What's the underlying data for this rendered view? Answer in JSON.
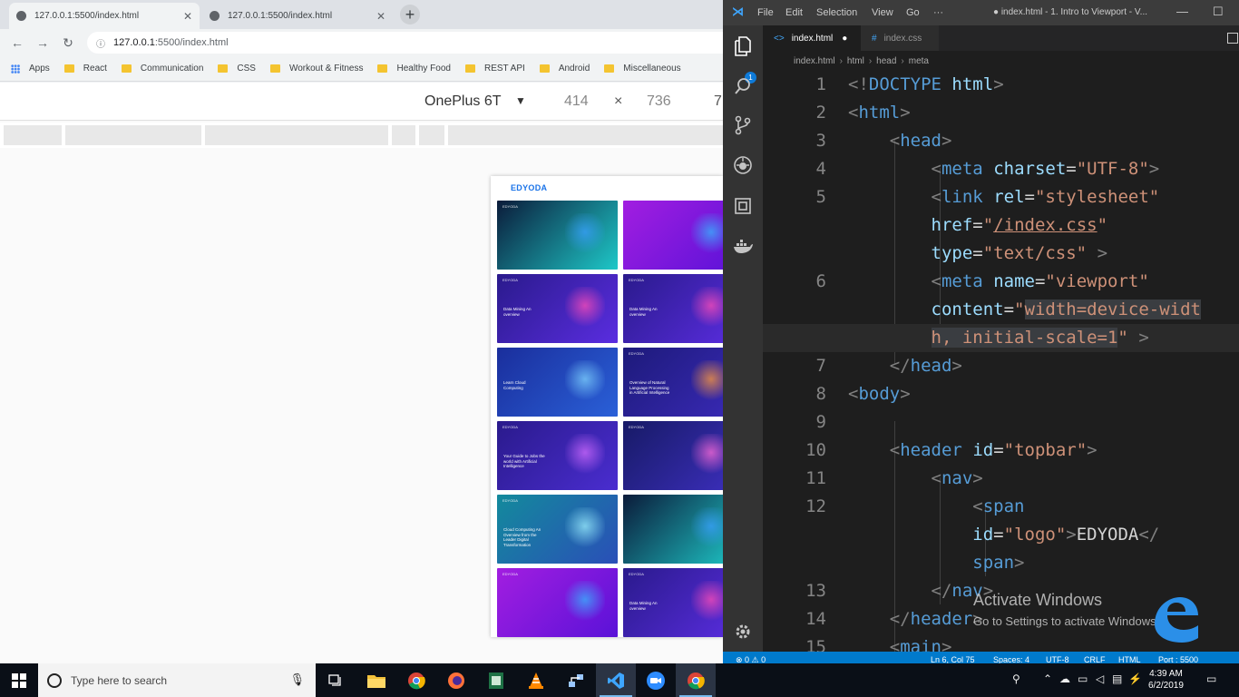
{
  "browser": {
    "tabs": [
      {
        "title": "127.0.0.1:5500/index.html",
        "close": "✕"
      },
      {
        "title": "127.0.0.1:5500/index.html",
        "close": "✕"
      }
    ],
    "new_tab": "+",
    "back": "←",
    "forward": "→",
    "reload": "↻",
    "url_info": "ⓘ",
    "url_host": "127.0.0.1",
    "url_path": ":5500/index.html",
    "bookmarks": [
      "Apps",
      "React",
      "Communication",
      "CSS",
      "Workout & Fitness",
      "Healthy Food",
      "REST API",
      "Android",
      "Miscellaneous"
    ],
    "devtools": {
      "device": "OnePlus 6T",
      "caret": "▼",
      "width": "414",
      "times": "×",
      "height": "736",
      "zoom": "7"
    },
    "page": {
      "logo": "EDYODA",
      "cards": [
        {
          "brand": "EDYODA",
          "text": "",
          "c1": "#0b1b3a",
          "c2": "#1ec8c8",
          "illo": "#3aa0ff"
        },
        {
          "brand": "",
          "text": "",
          "c1": "#a21ee0",
          "c2": "#5a12d8",
          "illo": "#35b8ff"
        },
        {
          "brand": "EDYODA",
          "text": "Data Mining An overview",
          "c1": "#2a1a8c",
          "c2": "#5a2de0",
          "illo": "#ff4db8"
        },
        {
          "brand": "EDYODA",
          "text": "Data Mining An overview",
          "c1": "#2a1a8c",
          "c2": "#5a2de0",
          "illo": "#ff4db8"
        },
        {
          "brand": "",
          "text": "Learn Cloud Computing",
          "c1": "#1a2e9c",
          "c2": "#2a60d8",
          "illo": "#7fd4ff"
        },
        {
          "brand": "EDYODA",
          "text": "Overview of Natural Language Processing in Artificial Intelligence",
          "c1": "#1d1a7a",
          "c2": "#3a2ab8",
          "illo": "#ff9a3c"
        },
        {
          "brand": "EDYODA",
          "text": "Your Guide to Jobs the world with Artificial Intelligence",
          "c1": "#2a1a8c",
          "c2": "#4a2dd0",
          "illo": "#d26bff"
        },
        {
          "brand": "EDYODA",
          "text": "",
          "c1": "#171a66",
          "c2": "#3d2fbf",
          "illo": "#ff6bd8"
        },
        {
          "brand": "EDYODA",
          "text": "Cloud Computing An Overview from the Leader Digital Transformation",
          "c1": "#138a9c",
          "c2": "#2a4fb8",
          "illo": "#9cf0ff"
        },
        {
          "brand": "",
          "text": "",
          "c1": "#0b1b3a",
          "c2": "#1ec8c8",
          "illo": "#3aa0ff"
        },
        {
          "brand": "EDYODA",
          "text": "",
          "c1": "#a21ee0",
          "c2": "#5a12d8",
          "illo": "#35b8ff"
        },
        {
          "brand": "EDYODA",
          "text": "Data Mining An overview",
          "c1": "#2a1a8c",
          "c2": "#5a2de0",
          "illo": "#ff4db8"
        }
      ]
    }
  },
  "vscode": {
    "menu": [
      "File",
      "Edit",
      "Selection",
      "View",
      "Go",
      "···"
    ],
    "window_title": "● index.html - 1. Intro to Viewport - V...",
    "window_min": "—",
    "window_max": "☐",
    "badge": "1",
    "tabs": [
      {
        "label": "index.html",
        "modified": "●"
      },
      {
        "label": "index.css"
      }
    ],
    "breadcrumb": [
      "index.html",
      "html",
      "head",
      "meta"
    ],
    "breadcrumb_sep": "›",
    "line_numbers": [
      "1",
      "2",
      "3",
      "4",
      "5",
      "",
      "",
      "6",
      "",
      "",
      "7",
      "8",
      "9",
      "10",
      "11",
      "12",
      "",
      "",
      "13",
      "14",
      "15"
    ],
    "status": {
      "problems": "⊗ 0 ⚠ 0",
      "position": "Ln 6, Col 75",
      "spaces": "Spaces: 4",
      "encoding": "UTF-8",
      "eol": "CRLF",
      "language": "HTML",
      "port": "Port : 5500"
    }
  },
  "watermark": {
    "title": "Activate Windows",
    "subtitle": "Go to Settings to activate Windows."
  },
  "taskbar": {
    "search_placeholder": "Type here to search",
    "time": "4:39 AM",
    "date": "6/2/2019"
  },
  "colors": {
    "vscode_blue": "#007acc",
    "edyoda_blue": "#1a73e8",
    "tag_blue": "#569cd6",
    "attr_blue": "#9cdcfe",
    "string_orange": "#ce9178"
  }
}
